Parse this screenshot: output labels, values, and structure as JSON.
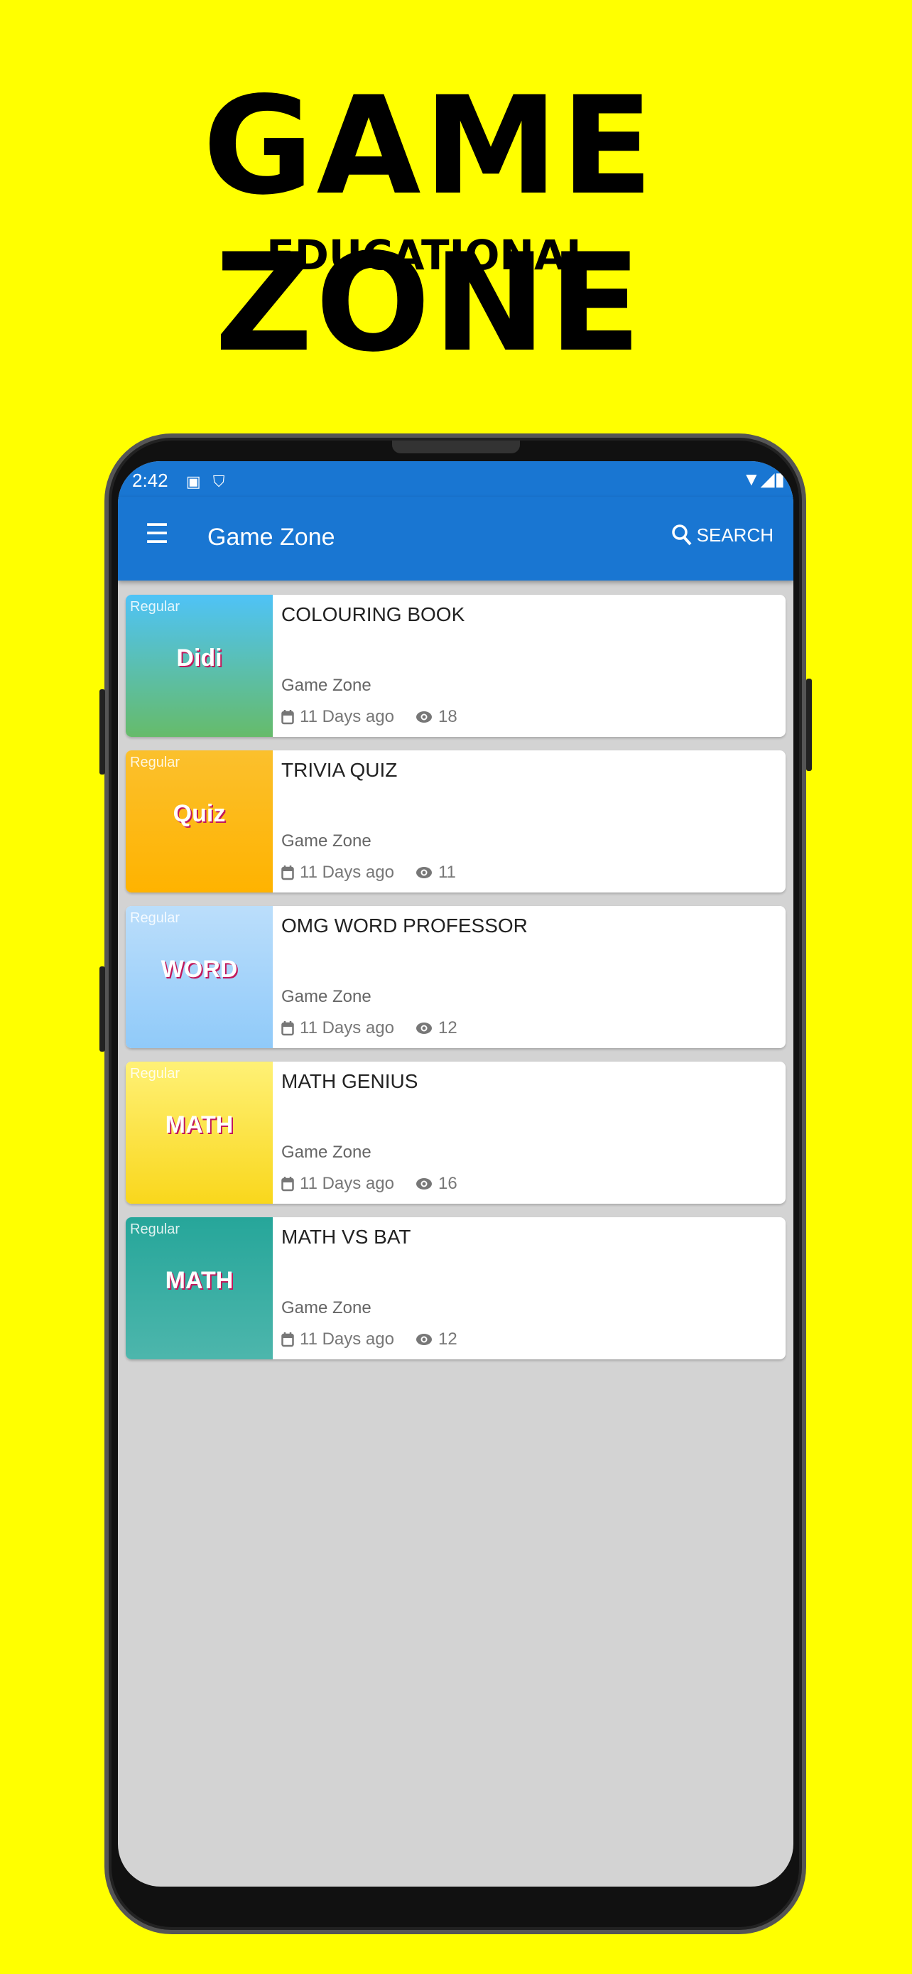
{
  "promo": {
    "headline": "GAME ZONE",
    "subtitle": "EDUCATIONAL"
  },
  "status_bar": {
    "time": "2:42"
  },
  "app_bar": {
    "title": "Game Zone",
    "search_label": "SEARCH"
  },
  "colors": {
    "background": "#ffff00",
    "primary": "#1976d2"
  },
  "games": [
    {
      "badge": "Regular",
      "art": "Didi",
      "title": "COLOURING BOOK",
      "source": "Game Zone",
      "age": "11 Days ago",
      "views": "18",
      "bg": "linear-gradient(180deg,#4fc3f7,#66bb6a)"
    },
    {
      "badge": "Regular",
      "art": "Quiz",
      "title": "TRIVIA QUIZ",
      "source": "Game Zone",
      "age": "11 Days ago",
      "views": "11",
      "bg": "linear-gradient(180deg,#fbc02d,#ffb300)"
    },
    {
      "badge": "Regular",
      "art": "WORD",
      "title": "OMG WORD PROFESSOR",
      "source": "Game Zone",
      "age": "11 Days ago",
      "views": "12",
      "bg": "linear-gradient(180deg,#bbdefb,#90caf9)"
    },
    {
      "badge": "Regular",
      "art": "MATH",
      "title": "MATH GENIUS",
      "source": "Game Zone",
      "age": "11 Days ago",
      "views": "16",
      "bg": "linear-gradient(180deg,#fff176,#f9d71c)"
    },
    {
      "badge": "Regular",
      "art": "MATH",
      "title": "MATH VS BAT",
      "source": "Game Zone",
      "age": "11 Days ago",
      "views": "12",
      "bg": "linear-gradient(180deg,#26a69a,#4db6ac)"
    }
  ]
}
